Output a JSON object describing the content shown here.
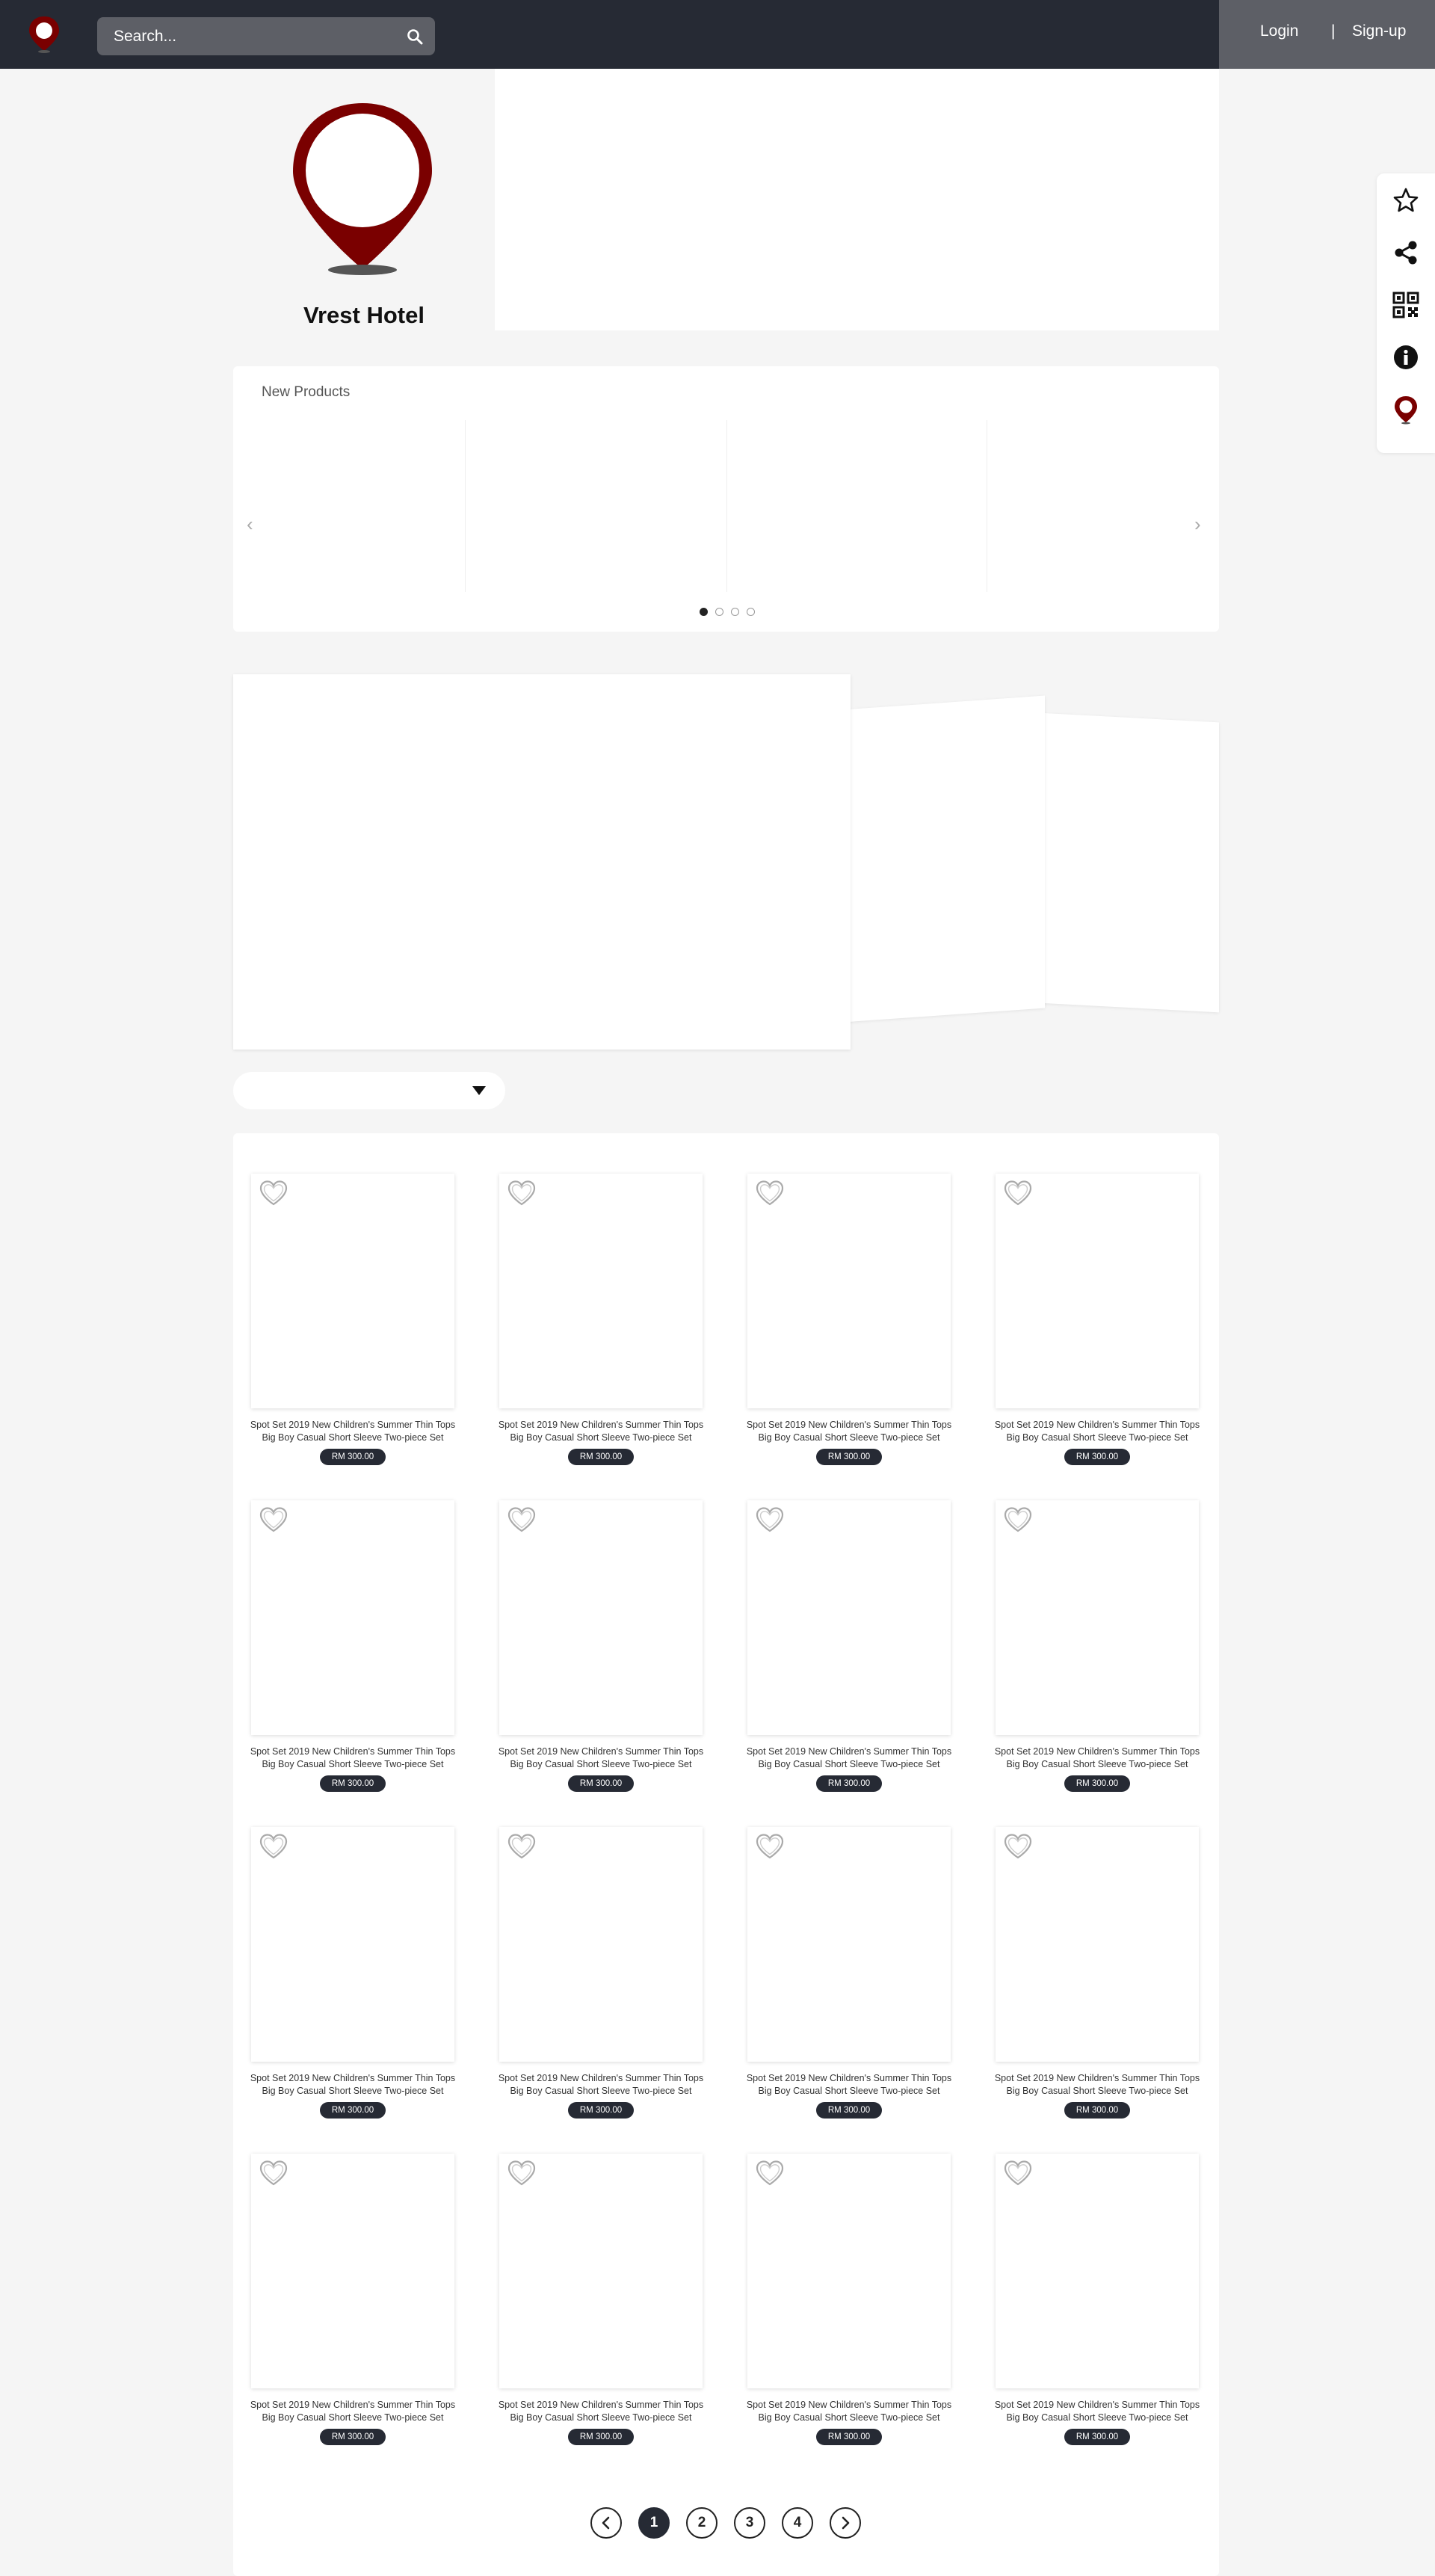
{
  "header": {
    "logo_icon": "location-pin-icon",
    "search": {
      "placeholder": "Search...",
      "icon": "search-icon"
    },
    "login_label": "Login",
    "separator": "|",
    "signup_label": "Sign-up"
  },
  "side_toolbar": {
    "items": [
      {
        "icon": "star-icon"
      },
      {
        "icon": "share-icon"
      },
      {
        "icon": "qr-code-icon"
      },
      {
        "icon": "info-icon"
      },
      {
        "icon": "location-pin-icon"
      }
    ]
  },
  "profile": {
    "name": "Vrest Hotel",
    "logo_icon": "location-pin-icon"
  },
  "new_products": {
    "title": "New Products",
    "prev_label": "‹",
    "next_label": "›",
    "page_count": 4,
    "active_page": 1
  },
  "products": {
    "items": [
      {
        "name": "Spot Set 2019 New Children's Summer Thin Tops Big Boy Casual Short Sleeve Two-piece Set",
        "price": "RM 300.00"
      },
      {
        "name": "Spot Set 2019 New Children's Summer Thin Tops Big Boy Casual Short Sleeve Two-piece Set",
        "price": "RM 300.00"
      },
      {
        "name": "Spot Set 2019 New Children's Summer Thin Tops Big Boy Casual Short Sleeve Two-piece Set",
        "price": "RM 300.00"
      },
      {
        "name": "Spot Set 2019 New Children's Summer Thin Tops Big Boy Casual Short Sleeve Two-piece Set",
        "price": "RM 300.00"
      },
      {
        "name": "Spot Set 2019 New Children's Summer Thin Tops Big Boy Casual Short Sleeve Two-piece Set",
        "price": "RM 300.00"
      },
      {
        "name": "Spot Set 2019 New Children's Summer Thin Tops Big Boy Casual Short Sleeve Two-piece Set",
        "price": "RM 300.00"
      },
      {
        "name": "Spot Set 2019 New Children's Summer Thin Tops Big Boy Casual Short Sleeve Two-piece Set",
        "price": "RM 300.00"
      },
      {
        "name": "Spot Set 2019 New Children's Summer Thin Tops Big Boy Casual Short Sleeve Two-piece Set",
        "price": "RM 300.00"
      },
      {
        "name": "Spot Set 2019 New Children's Summer Thin Tops Big Boy Casual Short Sleeve Two-piece Set",
        "price": "RM 300.00"
      },
      {
        "name": "Spot Set 2019 New Children's Summer Thin Tops Big Boy Casual Short Sleeve Two-piece Set",
        "price": "RM 300.00"
      },
      {
        "name": "Spot Set 2019 New Children's Summer Thin Tops Big Boy Casual Short Sleeve Two-piece Set",
        "price": "RM 300.00"
      },
      {
        "name": "Spot Set 2019 New Children's Summer Thin Tops Big Boy Casual Short Sleeve Two-piece Set",
        "price": "RM 300.00"
      },
      {
        "name": "Spot Set 2019 New Children's Summer Thin Tops Big Boy Casual Short Sleeve Two-piece Set",
        "price": "RM 300.00"
      },
      {
        "name": "Spot Set 2019 New Children's Summer Thin Tops Big Boy Casual Short Sleeve Two-piece Set",
        "price": "RM 300.00"
      },
      {
        "name": "Spot Set 2019 New Children's Summer Thin Tops Big Boy Casual Short Sleeve Two-piece Set",
        "price": "RM 300.00"
      },
      {
        "name": "Spot Set 2019 New Children's Summer Thin Tops Big Boy Casual Short Sleeve Two-piece Set",
        "price": "RM 300.00"
      }
    ]
  },
  "pagination": {
    "prev_icon": "chevron-left-icon",
    "next_icon": "chevron-right-icon",
    "pages": [
      "1",
      "2",
      "3",
      "4"
    ],
    "active": "1"
  },
  "colors": {
    "header_bg": "#262a34",
    "panel_grey": "#5d5f66",
    "brand_red": "#7a0000",
    "page_bg": "#f5f5f5"
  }
}
